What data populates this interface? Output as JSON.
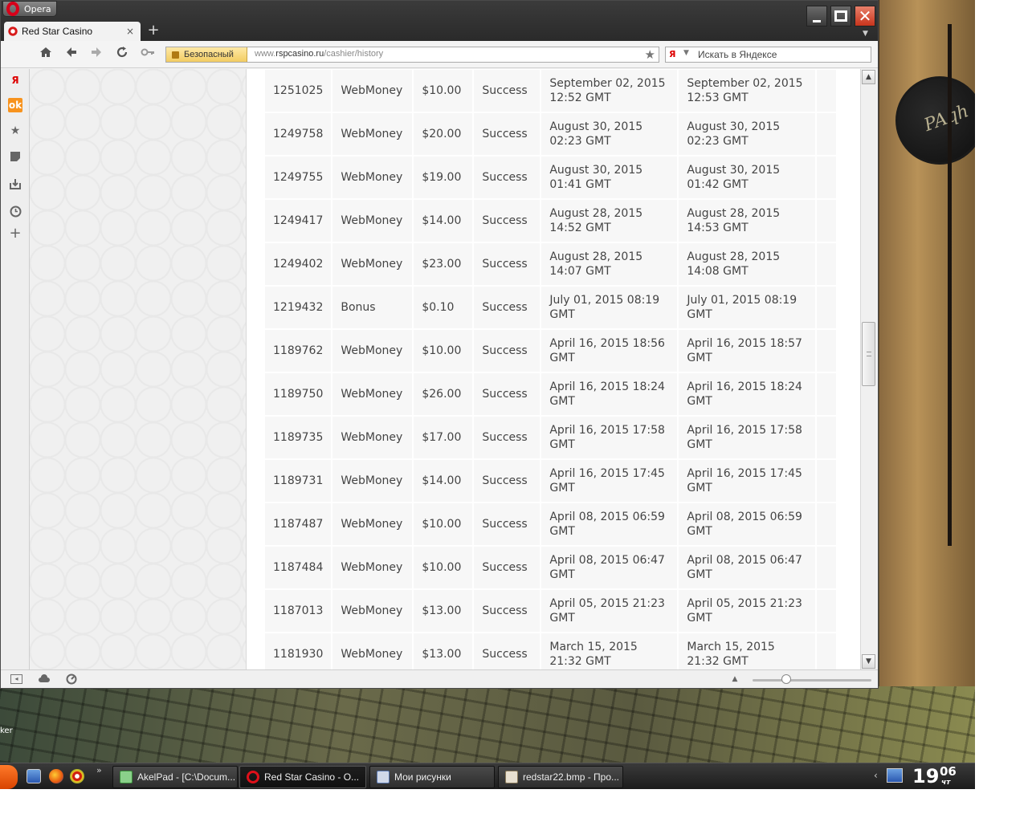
{
  "desktop": {
    "left_label": "ker"
  },
  "browser": {
    "menu_label": "Opera",
    "tab": {
      "title": "Red Star Casino",
      "close": "×"
    },
    "new_tab": "+",
    "window_close": "✕",
    "address": {
      "security_badge": "Безопасный",
      "url_prefix": "www.",
      "url_host": "rspcasino.ru",
      "url_path": "/cashier/history"
    },
    "search": {
      "placeholder": "Искать в Яндексе",
      "engine": "Я"
    },
    "sidebar": {
      "yandex": "Я",
      "odnoklassniki": "ok"
    }
  },
  "transactions": {
    "rows": [
      {
        "id": "1251025",
        "type": "WebMoney",
        "amount": "$10.00",
        "status": "Success",
        "created": "September 02, 2015 12:52 GMT",
        "processed": "September 02, 2015 12:53 GMT"
      },
      {
        "id": "1249758",
        "type": "WebMoney",
        "amount": "$20.00",
        "status": "Success",
        "created": "August 30, 2015 02:23 GMT",
        "processed": "August 30, 2015 02:23 GMT"
      },
      {
        "id": "1249755",
        "type": "WebMoney",
        "amount": "$19.00",
        "status": "Success",
        "created": "August 30, 2015 01:41 GMT",
        "processed": "August 30, 2015 01:42 GMT"
      },
      {
        "id": "1249417",
        "type": "WebMoney",
        "amount": "$14.00",
        "status": "Success",
        "created": "August 28, 2015 14:52 GMT",
        "processed": "August 28, 2015 14:53 GMT"
      },
      {
        "id": "1249402",
        "type": "WebMoney",
        "amount": "$23.00",
        "status": "Success",
        "created": "August 28, 2015 14:07 GMT",
        "processed": "August 28, 2015 14:08 GMT"
      },
      {
        "id": "1219432",
        "type": "Bonus",
        "amount": "$0.10",
        "status": "Success",
        "created": "July 01, 2015 08:19 GMT",
        "processed": "July 01, 2015 08:19 GMT"
      },
      {
        "id": "1189762",
        "type": "WebMoney",
        "amount": "$10.00",
        "status": "Success",
        "created": "April 16, 2015 18:56 GMT",
        "processed": "April 16, 2015 18:57 GMT"
      },
      {
        "id": "1189750",
        "type": "WebMoney",
        "amount": "$26.00",
        "status": "Success",
        "created": "April 16, 2015 18:24 GMT",
        "processed": "April 16, 2015 18:24 GMT"
      },
      {
        "id": "1189735",
        "type": "WebMoney",
        "amount": "$17.00",
        "status": "Success",
        "created": "April 16, 2015 17:58 GMT",
        "processed": "April 16, 2015 17:58 GMT"
      },
      {
        "id": "1189731",
        "type": "WebMoney",
        "amount": "$14.00",
        "status": "Success",
        "created": "April 16, 2015 17:45 GMT",
        "processed": "April 16, 2015 17:45 GMT"
      },
      {
        "id": "1187487",
        "type": "WebMoney",
        "amount": "$10.00",
        "status": "Success",
        "created": "April 08, 2015 06:59 GMT",
        "processed": "April 08, 2015 06:59 GMT"
      },
      {
        "id": "1187484",
        "type": "WebMoney",
        "amount": "$10.00",
        "status": "Success",
        "created": "April 08, 2015 06:47 GMT",
        "processed": "April 08, 2015 06:47 GMT"
      },
      {
        "id": "1187013",
        "type": "WebMoney",
        "amount": "$13.00",
        "status": "Success",
        "created": "April 05, 2015 21:23 GMT",
        "processed": "April 05, 2015 21:23 GMT"
      },
      {
        "id": "1181930",
        "type": "WebMoney",
        "amount": "$13.00",
        "status": "Success",
        "created": "March 15, 2015 21:32 GMT",
        "processed": "March 15, 2015 21:32 GMT"
      }
    ]
  },
  "taskbar": {
    "tasks": [
      {
        "label": "AkelPad - [C:\\Docum..."
      },
      {
        "label": "Red Star Casino - O..."
      },
      {
        "label": "Мои рисунки"
      },
      {
        "label": "redstar22.bmp - Про..."
      }
    ],
    "more": "»",
    "tray_arrow": "‹",
    "clock": {
      "hours": "19",
      "minutes": "06",
      "day": "чт"
    }
  },
  "icons": {
    "home": "home-icon",
    "back": "back-arrow-icon",
    "forward": "forward-arrow-icon",
    "reload": "reload-icon",
    "key": "key-icon",
    "bookmark": "star-icon"
  },
  "colors": {
    "accent": "#d8001a",
    "close_button": "#c8341c",
    "security_badge": "#f2cc62",
    "table_cell": "#f7f7f7"
  }
}
